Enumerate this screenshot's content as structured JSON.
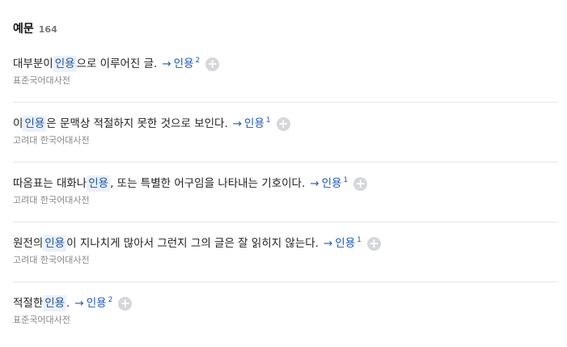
{
  "header": {
    "title": "예문",
    "count": "164"
  },
  "items": [
    {
      "pre": "대부분이 ",
      "hl": "인용",
      "post": "으로 이루어진 글.",
      "arrow": "→",
      "link": "인용",
      "sup": "2",
      "source": "표준국어대사전"
    },
    {
      "pre": "이 ",
      "hl": "인용",
      "post": "은 문맥상 적절하지 못한 것으로 보인다.",
      "arrow": "→",
      "link": "인용",
      "sup": "1",
      "source": "고려대 한국어대사전"
    },
    {
      "pre": "따옴표는 대화나 ",
      "hl": "인용",
      "post": ", 또는 특별한 어구임을 나타내는 기호이다.",
      "arrow": "→",
      "link": "인용",
      "sup": "1",
      "source": "고려대 한국어대사전"
    },
    {
      "pre": "원전의 ",
      "hl": "인용",
      "post": "이 지나치게 많아서 그런지 그의 글은 잘 읽히지 않는다.",
      "arrow": "→",
      "link": "인용",
      "sup": "1",
      "source": "고려대 한국어대사전"
    },
    {
      "pre": "적절한 ",
      "hl": "인용",
      "post": ".",
      "arrow": "→",
      "link": "인용",
      "sup": "2",
      "source": "표준국어대사전"
    }
  ],
  "icons": {
    "add": "plus-circle-icon"
  }
}
